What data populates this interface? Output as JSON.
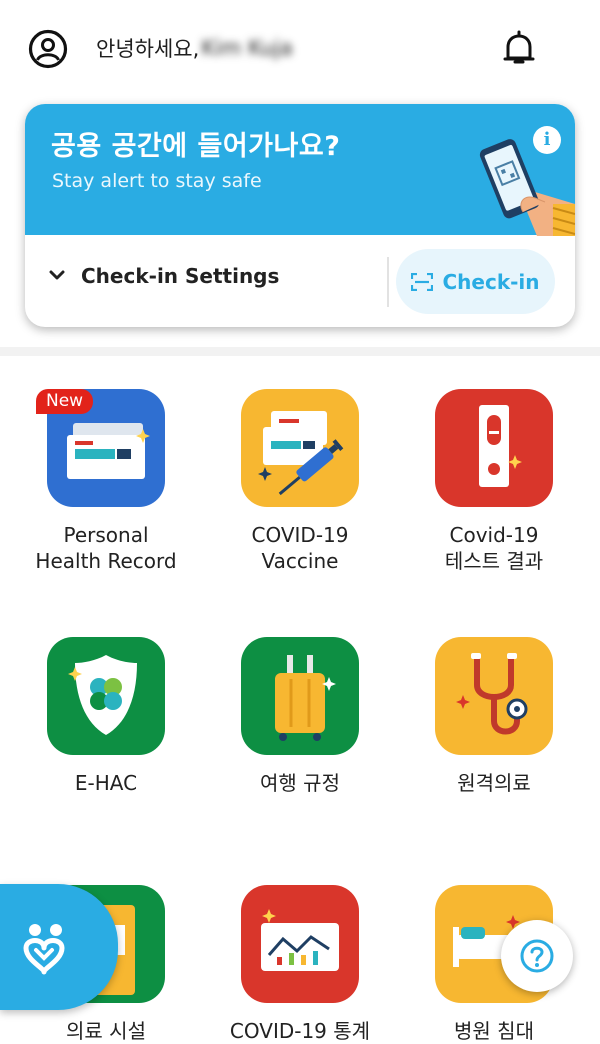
{
  "header": {
    "greeting": "안녕하세요,",
    "username": "Kim Kuja"
  },
  "banner": {
    "title": "공용 공간에 들어가나요?",
    "subtitle": "Stay alert to stay safe",
    "info_glyph": "i",
    "settings_label": "Check-in Settings",
    "checkin_label": "Check-in"
  },
  "badge": {
    "new": "New"
  },
  "tiles": [
    {
      "line1": "Personal",
      "line2": "Health Record",
      "icon": "health-record-icon",
      "bg": "#2f6fd1"
    },
    {
      "line1": "COVID-19",
      "line2": "Vaccine",
      "icon": "vaccine-icon",
      "bg": "#f7b731"
    },
    {
      "line1": "Covid-19",
      "line2": "테스트 결과",
      "icon": "test-result-icon",
      "bg": "#d9362b"
    },
    {
      "line1": "E-HAC",
      "line2": "",
      "icon": "shield-icon",
      "bg": "#0d8f43"
    },
    {
      "line1": "여행 규정",
      "line2": "",
      "icon": "luggage-icon",
      "bg": "#0d8f43"
    },
    {
      "line1": "원격의료",
      "line2": "",
      "icon": "stethoscope-icon",
      "bg": "#f7b731"
    },
    {
      "line1": "의료 시설",
      "line2": "",
      "icon": "medical-facility-icon",
      "bg": "#0d8f43"
    },
    {
      "line1": "COVID-19 통계",
      "line2": "",
      "icon": "statistics-icon",
      "bg": "#d9362b"
    },
    {
      "line1": "병원 침대",
      "line2": "",
      "icon": "hospital-bed-icon",
      "bg": "#f7b731"
    }
  ],
  "help": {
    "glyph": "?"
  },
  "colors": {
    "accent": "#2aace3",
    "red": "#d9362b",
    "green": "#0d8f43",
    "yellow": "#f7b731",
    "blue": "#2f6fd1"
  }
}
